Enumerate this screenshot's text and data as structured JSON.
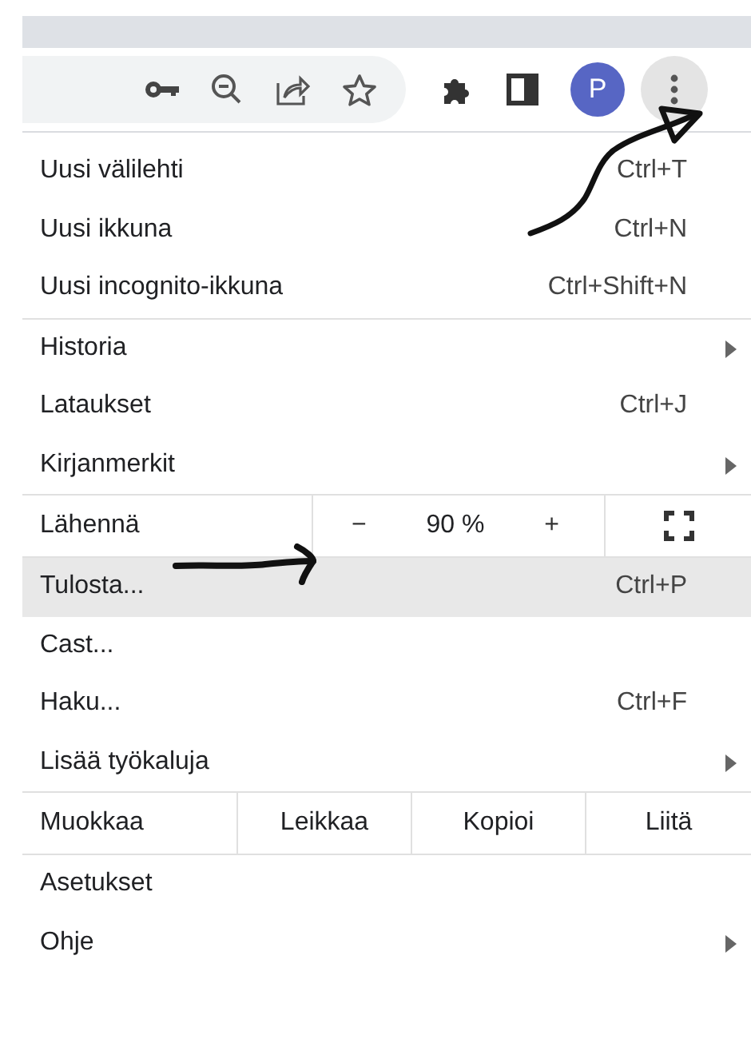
{
  "toolbar": {
    "avatar_letter": "P",
    "menu_open": true
  },
  "menu": [
    [
      {
        "kind": "item",
        "label": "Uusi välilehti",
        "shortcut": "Ctrl+T",
        "submenu": false,
        "selected": false
      },
      {
        "kind": "item",
        "label": "Uusi ikkuna",
        "shortcut": "Ctrl+N",
        "submenu": false,
        "selected": false
      },
      {
        "kind": "item",
        "label": "Uusi incognito-ikkuna",
        "shortcut": "Ctrl+Shift+N",
        "submenu": false,
        "selected": false
      }
    ],
    [
      {
        "kind": "item",
        "label": "Historia",
        "submenu": true,
        "selected": false
      },
      {
        "kind": "item",
        "label": "Lataukset",
        "shortcut": "Ctrl+J",
        "submenu": false,
        "selected": false
      },
      {
        "kind": "item",
        "label": "Kirjanmerkit",
        "submenu": true,
        "selected": false
      }
    ],
    [
      {
        "kind": "zoom",
        "label": "Lähennä",
        "minus": "−",
        "value": "90 %",
        "plus": "+"
      }
    ],
    [
      {
        "kind": "item",
        "label": "Tulosta...",
        "shortcut": "Ctrl+P",
        "submenu": false,
        "selected": true
      },
      {
        "kind": "item",
        "label": "Cast...",
        "submenu": false,
        "selected": false
      },
      {
        "kind": "item",
        "label": "Haku...",
        "shortcut": "Ctrl+F",
        "submenu": false,
        "selected": false
      },
      {
        "kind": "item",
        "label": "Lisää työkaluja",
        "submenu": true,
        "selected": false
      }
    ],
    [
      {
        "kind": "edit",
        "label": "Muokkaa",
        "actions": [
          "Leikkaa",
          "Kopioi",
          "Liitä"
        ]
      }
    ],
    [
      {
        "kind": "item",
        "label": "Asetukset",
        "submenu": false,
        "selected": false
      },
      {
        "kind": "item",
        "label": "Ohje",
        "submenu": true,
        "selected": false
      }
    ]
  ]
}
